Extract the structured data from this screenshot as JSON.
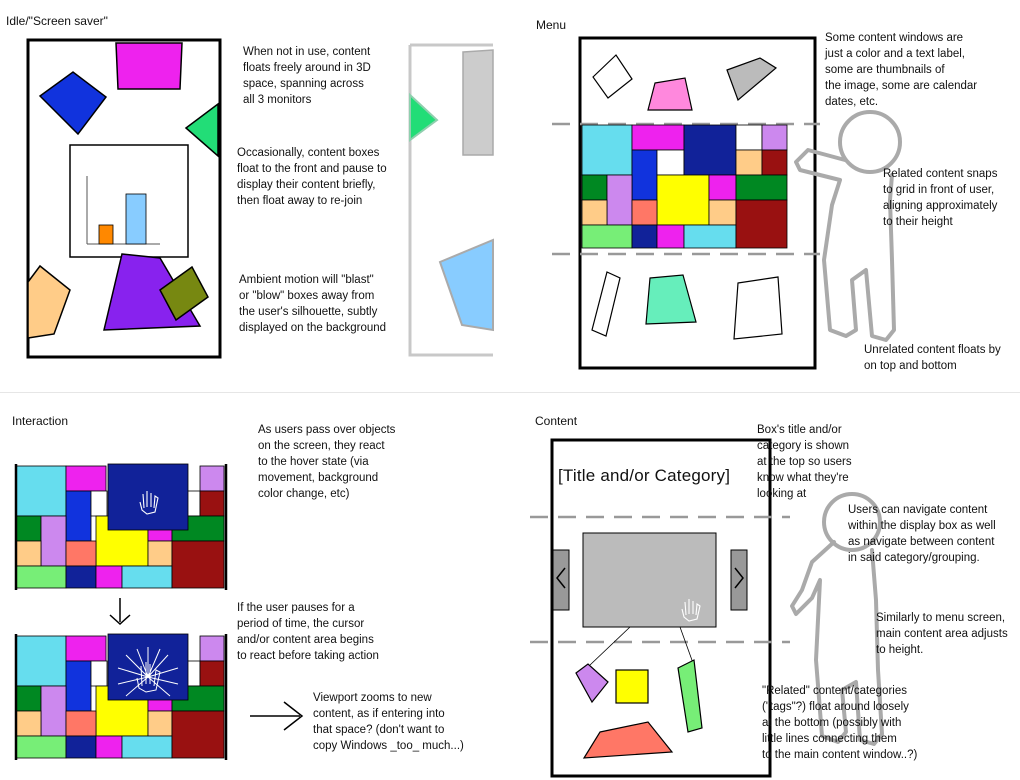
{
  "panels": [
    {
      "title": "Idle/\"Screen saver\""
    },
    {
      "title": "Menu"
    },
    {
      "title": "Interaction"
    },
    {
      "title": "Content"
    }
  ],
  "idle_notes": [
    "When not in use, content\nfloats freely around in 3D\nspace, spanning across\nall 3 monitors",
    "Occasionally, content boxes\nfloat to the front and pause to\ndisplay their content briefly,\nthen float away to re-join",
    "Ambient motion will \"blast\"\nor \"blow\" boxes away from\nthe user's silhouette, subtly\ndisplayed on the background"
  ],
  "menu_notes": [
    "Some content windows are\njust a color and a text label,\nsome are thumbnails of\nthe image, some are calendar\ndates, etc.",
    "Related content snaps\nto grid in front of user,\naligning approximately\nto their height",
    "Unrelated content floats by\non top and bottom"
  ],
  "interaction_notes": [
    "As users pass over objects\non the screen, they react\nto the hover state (via\nmovement, background\ncolor change, etc)",
    "If the user pauses for a\nperiod of time, the cursor\nand/or content area begins\nto react before taking action",
    "Viewport zooms to new\ncontent, as if entering into\nthat space? (don't want to\ncopy Windows _too_ much...)"
  ],
  "content_notes": [
    "Box's title and/or\ncategory is shown\nat the top so users\nknow what they're\nlooking at",
    "Users can navigate content\nwithin the display box as well\nas navigate between content\nin said category/grouping.",
    "Similarly to menu screen,\nmain content area adjusts\nto height.",
    "\"Related\" content/categories\n(\"tags\"?) float around loosely\nat the bottom (possibly with\nlittle lines connecting them\nto the main content window..?)"
  ],
  "content_box_title": "[Title and/or Category]",
  "colors": {
    "magenta": "#ee22ee",
    "cyan": "#66ddee",
    "blue": "#1133dd",
    "navy": "#112299",
    "yellow": "#ffff00",
    "green": "#008822",
    "lime": "#77ee77",
    "peach": "#ffcc88",
    "lavender": "#cc88ee",
    "salmon": "#ff7766",
    "maroon": "#991111",
    "purple": "#8822ee",
    "olive": "#778811",
    "mint": "#66eebb",
    "pink": "#ff88dd",
    "gray": "#bbbbbb",
    "gray_dark": "#999999",
    "sky": "#88ccff",
    "orange": "#ff8800",
    "seagreen": "#22dd77"
  }
}
